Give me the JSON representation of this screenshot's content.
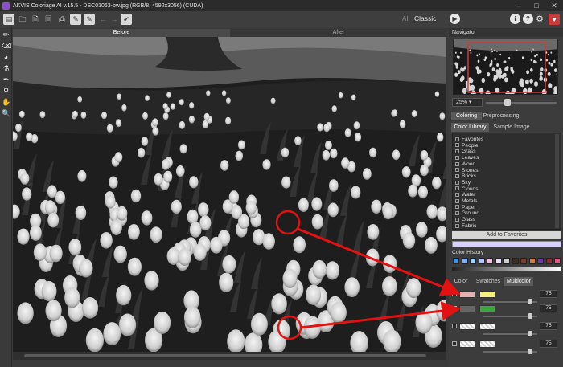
{
  "window": {
    "title": "AKVIS Coloriage AI v.15.5 - DSC01063-bw.jpg (RGB/8, 4592x3056) (CUDA)",
    "min_glyph": "–",
    "max_glyph": "□",
    "close_glyph": "✕"
  },
  "toolbar": {
    "mode_ai": "AI",
    "mode_classic": "Classic"
  },
  "canvas": {
    "tab_before": "Before",
    "tab_after": "After"
  },
  "navigator": {
    "title": "Navigator",
    "zoom": "25%"
  },
  "tabs": {
    "coloring": "Coloring",
    "preprocessing": "Preprocessing",
    "color_library": "Color Library",
    "sample_image": "Sample Image"
  },
  "library": {
    "items": [
      "Favorites",
      "People",
      "Grass",
      "Leaves",
      "Wood",
      "Stones",
      "Bricks",
      "Sky",
      "Clouds",
      "Water",
      "Metals",
      "Paper",
      "Ground",
      "Glass",
      "Fabric"
    ],
    "add_button": "Add to Favorites"
  },
  "history": {
    "label": "Color History",
    "swatches": [
      "#4a90d9",
      "#7fb0ff",
      "#9fd3ff",
      "#b7c3ff",
      "#f0c0e0",
      "#e8e0ff",
      "#cfcfcf",
      "#3d2f1f",
      "#7a3a2a",
      "#c98040",
      "#6a3fa0",
      "#8a2f2f",
      "#e05a8a"
    ]
  },
  "multicolor": {
    "tab_color": "Color",
    "tab_swatches": "Swatches",
    "tab_multicolor": "Multicolor",
    "rows": [
      {
        "checked": "✓",
        "value": "75"
      },
      {
        "checked": "✓",
        "value": "75"
      },
      {
        "checked": "",
        "value": "75"
      },
      {
        "checked": "",
        "value": "75"
      }
    ]
  },
  "colors": {
    "accent": "#8d4bd6",
    "annotation": "#e31212",
    "row1_swatch": "#f4f07a",
    "row2_swatch": "#3aa83a"
  }
}
